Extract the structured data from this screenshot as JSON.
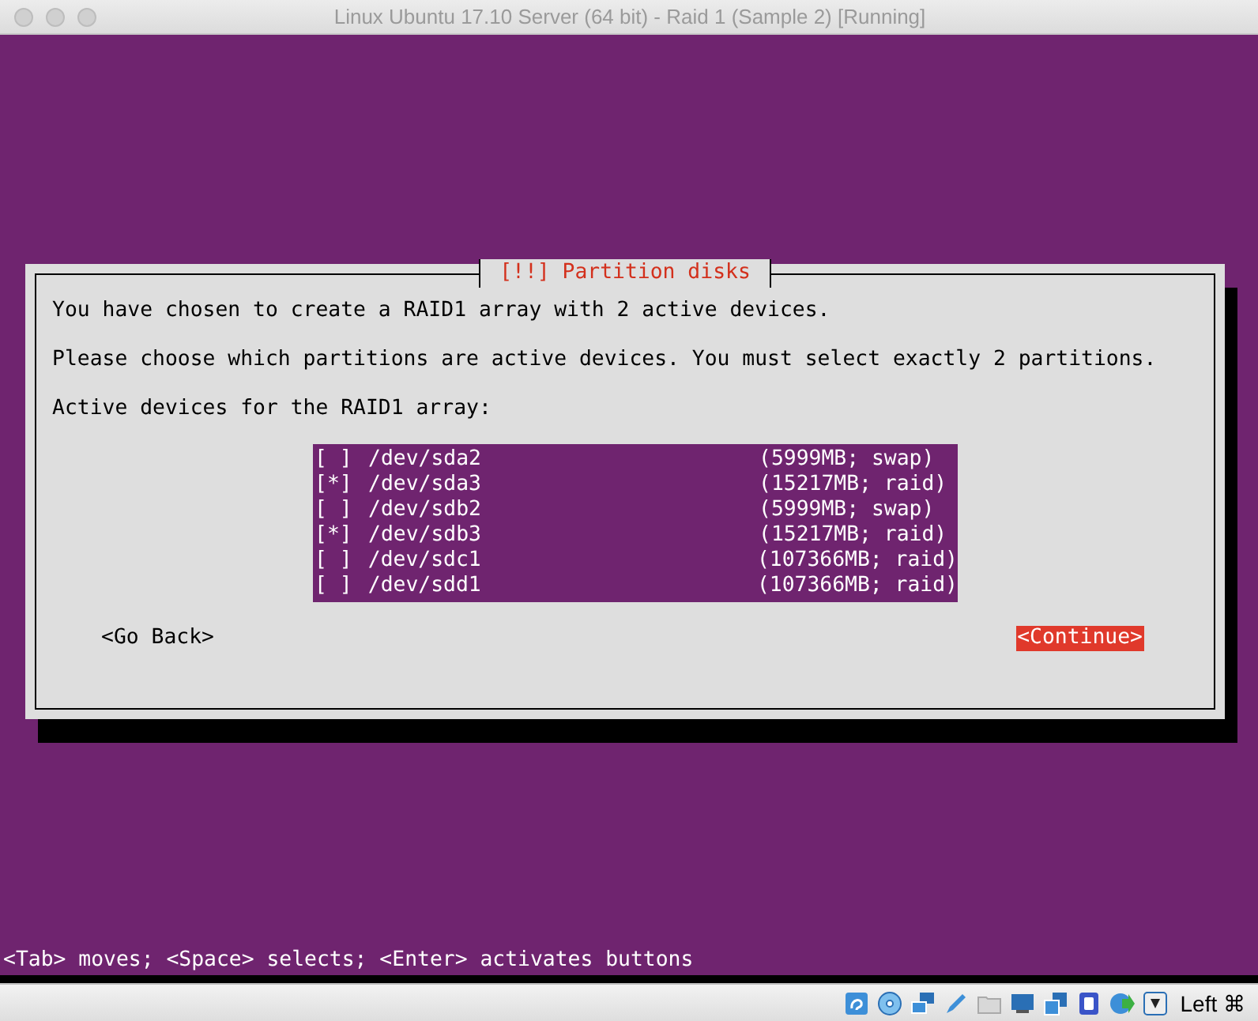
{
  "window": {
    "title": "Linux Ubuntu 17.10 Server (64 bit) - Raid 1 (Sample 2) [Running]"
  },
  "dialog": {
    "title": "[!!] Partition disks",
    "paragraphs": [
      "You have chosen to create a RAID1 array with 2 active devices.",
      "Please choose which partitions are active devices. You must select exactly 2 partitions.",
      "Active devices for the RAID1 array:"
    ],
    "devices": [
      {
        "mark": "[ ]",
        "device": "/dev/sda2",
        "info": "(5999MB; swap)"
      },
      {
        "mark": "[*]",
        "device": "/dev/sda3",
        "info": "(15217MB; raid)"
      },
      {
        "mark": "[ ]",
        "device": "/dev/sdb2",
        "info": "(5999MB; swap)"
      },
      {
        "mark": "[*]",
        "device": "/dev/sdb3",
        "info": "(15217MB; raid)"
      },
      {
        "mark": "[ ]",
        "device": "/dev/sdc1",
        "info": "(107366MB; raid)"
      },
      {
        "mark": "[ ]",
        "device": "/dev/sdd1",
        "info": "(107366MB; raid)"
      }
    ],
    "buttons": [
      {
        "label": "<Go Back>",
        "selected": false
      },
      {
        "label": "<Continue>",
        "selected": true
      }
    ]
  },
  "help_line": "<Tab> moves; <Space> selects; <Enter> activates buttons",
  "status_bar": {
    "host_key": "Left ⌘"
  }
}
